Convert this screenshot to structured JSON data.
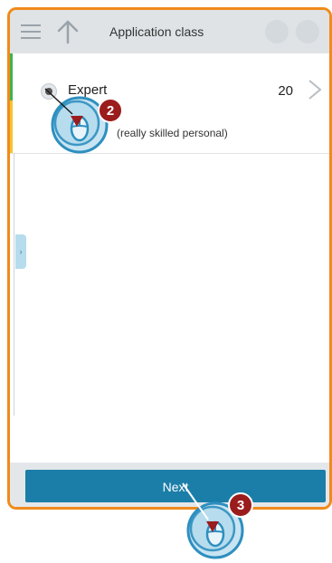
{
  "header": {
    "title": "Application class",
    "menu_icon": "hamburger-icon",
    "back_icon": "up-arrow-icon"
  },
  "list": {
    "item": {
      "title": "Expert",
      "value": "20",
      "description": "(really skilled personal)",
      "selected": true
    }
  },
  "footer": {
    "next_label": "Next"
  },
  "annotations": {
    "step_badge_1": "2",
    "step_badge_2": "3"
  },
  "colors": {
    "frame_border": "#f08a1c",
    "accent_green": "#3fb34f",
    "accent_yellow": "#f6c22f",
    "next_button": "#1b7ea8",
    "step_badge": "#9b1c1c",
    "mouse_illustration": "#2d8fbf"
  }
}
